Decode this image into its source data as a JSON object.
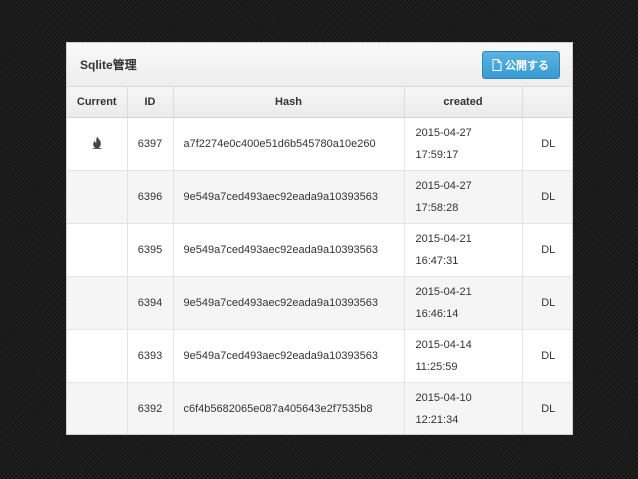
{
  "panel": {
    "title": "Sqlite管理",
    "publish_label": "公開する",
    "publish_icon": "document-icon"
  },
  "table": {
    "columns": [
      "Current",
      "ID",
      "Hash",
      "created",
      ""
    ],
    "rows": [
      {
        "current_icon": "flame-icon",
        "id": "6397",
        "hash": "a7f2274e0c400e51d6b545780a10e260",
        "date": "2015-04-27",
        "time": "17:59:17",
        "action": "DL"
      },
      {
        "current_icon": "",
        "id": "6396",
        "hash": "9e549a7ced493aec92eada9a10393563",
        "date": "2015-04-27",
        "time": "17:58:28",
        "action": "DL"
      },
      {
        "current_icon": "",
        "id": "6395",
        "hash": "9e549a7ced493aec92eada9a10393563",
        "date": "2015-04-21",
        "time": "16:47:31",
        "action": "DL"
      },
      {
        "current_icon": "",
        "id": "6394",
        "hash": "9e549a7ced493aec92eada9a10393563",
        "date": "2015-04-21",
        "time": "16:46:14",
        "action": "DL"
      },
      {
        "current_icon": "",
        "id": "6393",
        "hash": "9e549a7ced493aec92eada9a10393563",
        "date": "2015-04-14",
        "time": "11:25:59",
        "action": "DL"
      },
      {
        "current_icon": "",
        "id": "6392",
        "hash": "c6f4b5682065e087a405643e2f7535b8",
        "date": "2015-04-10",
        "time": "12:21:34",
        "action": "DL"
      }
    ]
  },
  "colors": {
    "accent": "#3a9ad2",
    "background": "#1b1b1b"
  }
}
